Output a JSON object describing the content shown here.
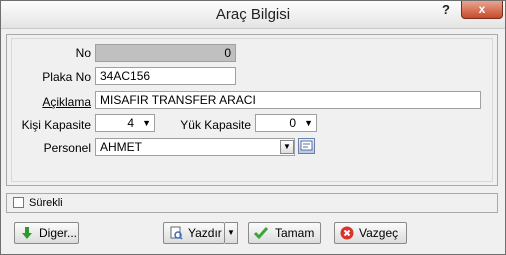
{
  "window": {
    "title": "Araç Bilgisi",
    "help_glyph": "?",
    "close_glyph": "x"
  },
  "form": {
    "no": {
      "label": "No",
      "value": "0"
    },
    "plaka": {
      "label": "Plaka No",
      "value": "34AC156"
    },
    "aciklama": {
      "label": "Açiklama",
      "value": "MISAFIR TRANSFER ARACI"
    },
    "kisi_kapasite": {
      "label": "Kişi Kapasite",
      "value": "4"
    },
    "yuk_kapasite": {
      "label": "Yük Kapasite",
      "value": "0"
    },
    "personel": {
      "label": "Personel",
      "value": "AHMET"
    }
  },
  "surekli": {
    "label": "Sürekli",
    "checked": false
  },
  "buttons": {
    "diger": "Diger...",
    "yazdir": "Yazdır",
    "tamam": "Tamam",
    "vazgec": "Vazgeç"
  },
  "colors": {
    "ok_green": "#3aa63a",
    "cancel_red": "#d9342b",
    "down_green": "#2e9a2e"
  }
}
